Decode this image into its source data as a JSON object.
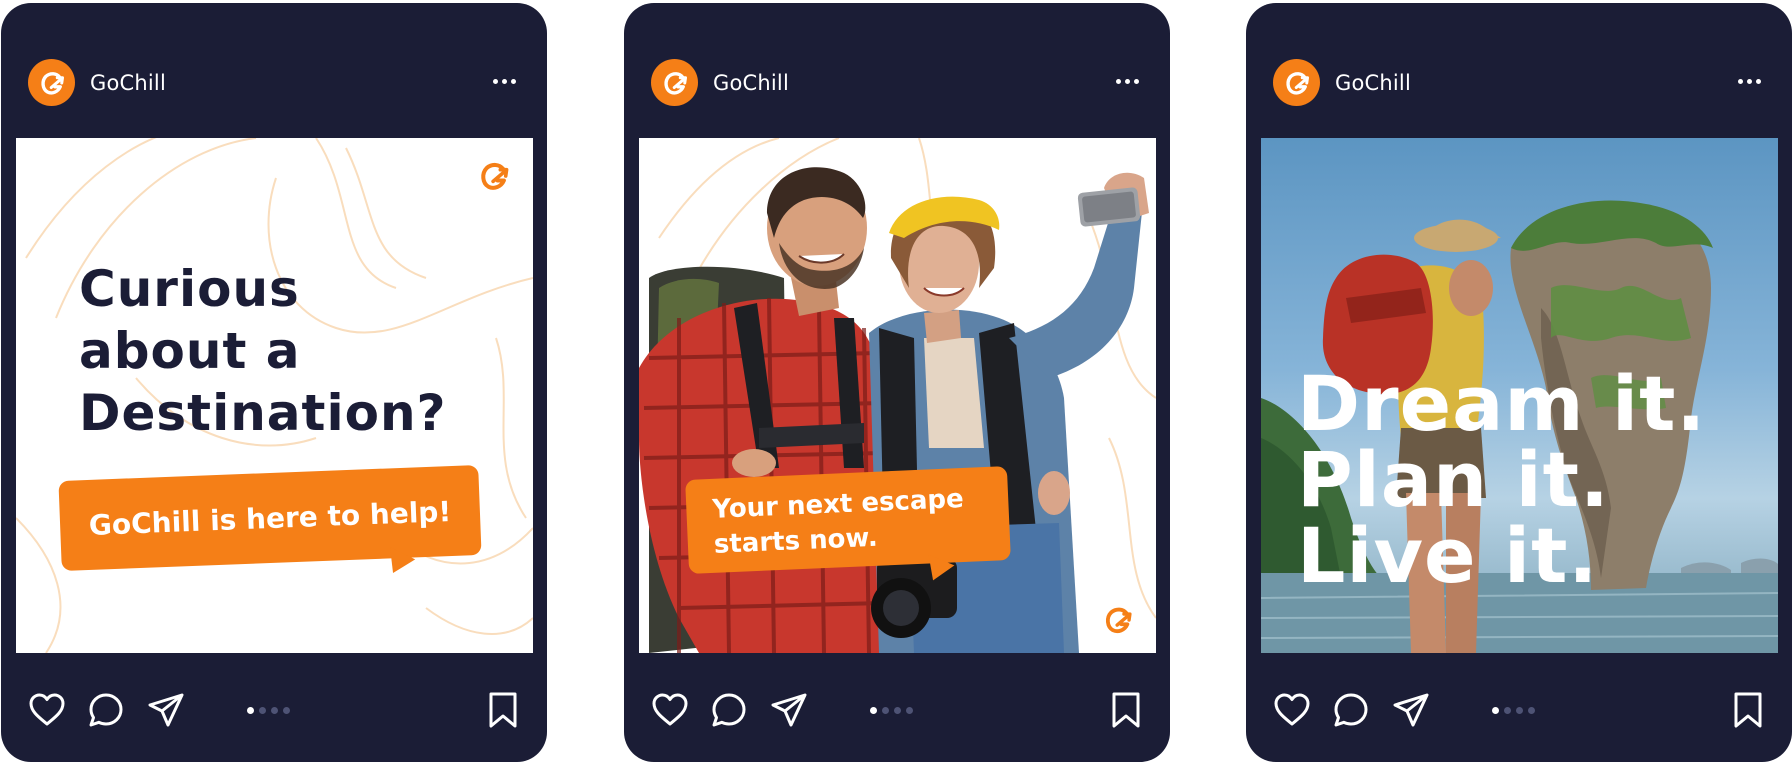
{
  "brand": {
    "accent": "#f57f17",
    "card_bg": "#1b1d36",
    "icon": "gochill-logo-icon"
  },
  "posts": [
    {
      "username": "GoChill",
      "headline": [
        "Curious",
        "about a",
        "Destination?"
      ],
      "callout": "GoChill is here to help!",
      "carousel": {
        "active": 1,
        "count": 4
      }
    },
    {
      "username": "GoChill",
      "callout": [
        "Your next escape",
        "starts now."
      ],
      "carousel": {
        "active": 1,
        "count": 4
      }
    },
    {
      "username": "GoChill",
      "headline": [
        "Dream it.",
        "Plan it.",
        "Live it."
      ],
      "carousel": {
        "active": 1,
        "count": 4
      }
    }
  ],
  "icons": {
    "like": "heart-icon",
    "comment": "comment-icon",
    "share": "send-icon",
    "save": "bookmark-icon",
    "more": "more-horizontal-icon"
  }
}
